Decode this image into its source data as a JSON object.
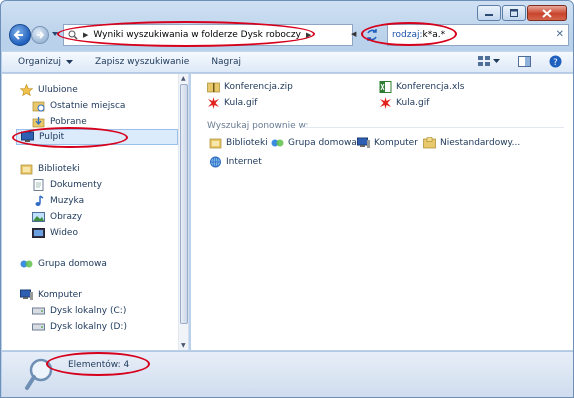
{
  "address": {
    "path": [
      "Wyniki wyszukiwania w folderze Dysk roboczy"
    ]
  },
  "search": {
    "keyword": "rodzaj:",
    "query": "k*a.*"
  },
  "toolbar": {
    "organize_label": "Organizuj",
    "save_search_label": "Zapisz wyszukiwanie",
    "burn_label": "Nagraj"
  },
  "nav": {
    "favorites_label": "Ulubione",
    "favorites": [
      "Ostatnie miejsca",
      "Pobrane",
      "Pulpit"
    ],
    "libraries_label": "Biblioteki",
    "libraries": [
      "Dokumenty",
      "Muzyka",
      "Obrazy",
      "Wideo"
    ],
    "homegroup_label": "Grupa domowa",
    "computer_label": "Komputer",
    "drives": [
      "Dysk lokalny (C:)",
      "Dysk lokalny (D:)"
    ]
  },
  "results": {
    "files": [
      {
        "name": "Konferencja.zip",
        "icon": "zip-folder-icon"
      },
      {
        "name": "Konferencja.xls",
        "icon": "excel-file-icon"
      },
      {
        "name": "Kula.gif",
        "icon": "gif-image-icon"
      },
      {
        "name": "Kula.gif",
        "icon": "gif-image-icon"
      }
    ],
    "search_again_label": "Wyszukaj ponownie w:",
    "search_again": [
      "Biblioteki",
      "Grupa domowa",
      "Komputer",
      "Niestandardowy...",
      "Internet"
    ]
  },
  "status": {
    "count_text": "Elementów: 4"
  },
  "colors": {
    "highlight_oval": "#d6001c",
    "selected_bg": "#dcebfc",
    "text": "#1e395b"
  }
}
